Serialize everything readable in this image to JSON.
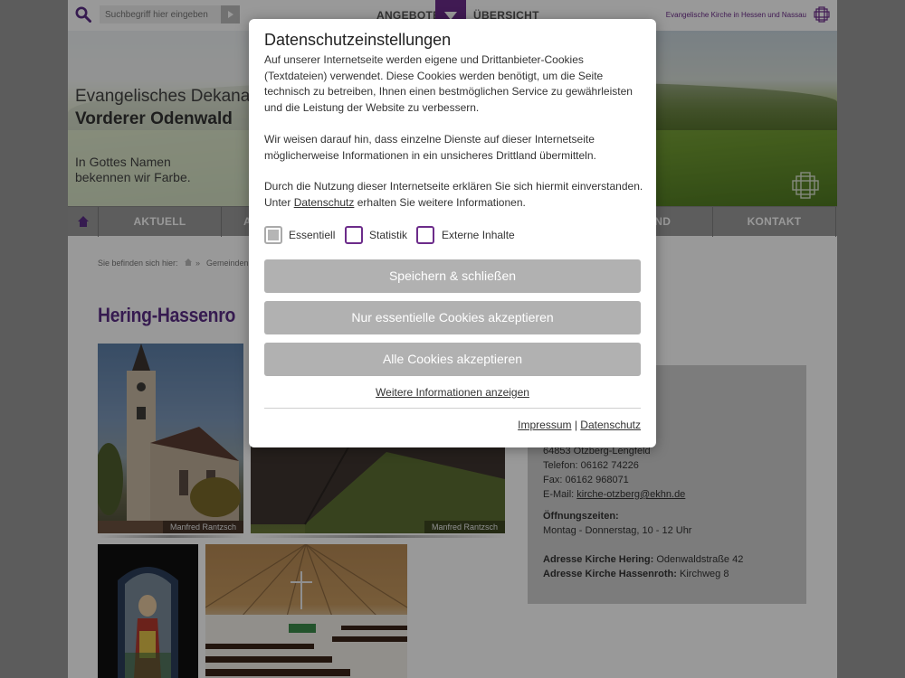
{
  "header": {
    "search_placeholder": "Suchbegriff hier eingeben",
    "nav_angebote": "ANGEBOTE",
    "nav_uebersicht": "ÜBERSICHT",
    "ekhn_label": "Evangelische Kirche in Hessen und Nassau"
  },
  "banner": {
    "line1": "Evangelisches Dekanat",
    "line2": "Vorderer Odenwald",
    "motto1": "In Gottes Namen",
    "motto2": "bekennen wir Farbe."
  },
  "nav": {
    "items": [
      "AKTUELL",
      "A",
      "END",
      "KONTAKT"
    ]
  },
  "breadcrumb": {
    "label": "Sie befinden sich hier:",
    "separator": "»",
    "item": "Gemeinden"
  },
  "page": {
    "title": "Hering-Hassenro"
  },
  "photos": {
    "caption1": "Manfred Rantzsch",
    "caption2": "Manfred Rantzsch"
  },
  "contact": {
    "city": "64853 Otzberg-Lengfeld",
    "phone": "Telefon: 06162 74226",
    "fax": "Fax: 06162 968071",
    "email_label": "E-Mail:",
    "email": "kirche-otzberg@ekhn.de",
    "hours_label": "Öffnungszeiten:",
    "hours": "Montag - Donnerstag, 10 - 12 Uhr",
    "church1_label": "Adresse Kirche Hering:",
    "church1_addr": "Odenwaldstraße 42",
    "church2_label": "Adresse Kirche Hassenroth:",
    "church2_addr": "Kirchweg 8"
  },
  "cookie_dialog": {
    "title": "Datenschutzeinstellungen",
    "paragraph1": "Auf unserer Internetseite werden eigene und Drittanbieter-Cookies (Textdateien) verwendet. Diese Cookies werden benötigt, um die Seite technisch zu betreiben, Ihnen einen bestmöglichen Service zu gewährleisten und die Leistung der Website zu verbessern.",
    "paragraph2": "Wir weisen darauf hin, dass einzelne Dienste auf dieser Internetseite möglicherweise Informationen in ein unsicheres Drittland übermitteln.",
    "paragraph3_pre": "Durch die Nutzung dieser Internetseite erklären Sie sich hiermit einverstanden. Unter",
    "paragraph3_link": "Datenschutz",
    "paragraph3_post": "erhalten Sie weitere Informationen.",
    "checkbox_essential": "Essentiell",
    "checkbox_statistics": "Statistik",
    "checkbox_external": "Externe Inhalte",
    "btn_save": "Speichern & schließen",
    "btn_essential": "Nur essentielle Cookies akzeptieren",
    "btn_all": "Alle Cookies akzeptieren",
    "more_info": "Weitere Informationen anzeigen",
    "footer_impressum": "Impressum",
    "footer_sep": "|",
    "footer_datenschutz": "Datenschutz"
  },
  "colors": {
    "brand_purple": "#6c2c8a",
    "button_gray": "#b1b1b1",
    "nav_gray": "#9b9b9b"
  }
}
